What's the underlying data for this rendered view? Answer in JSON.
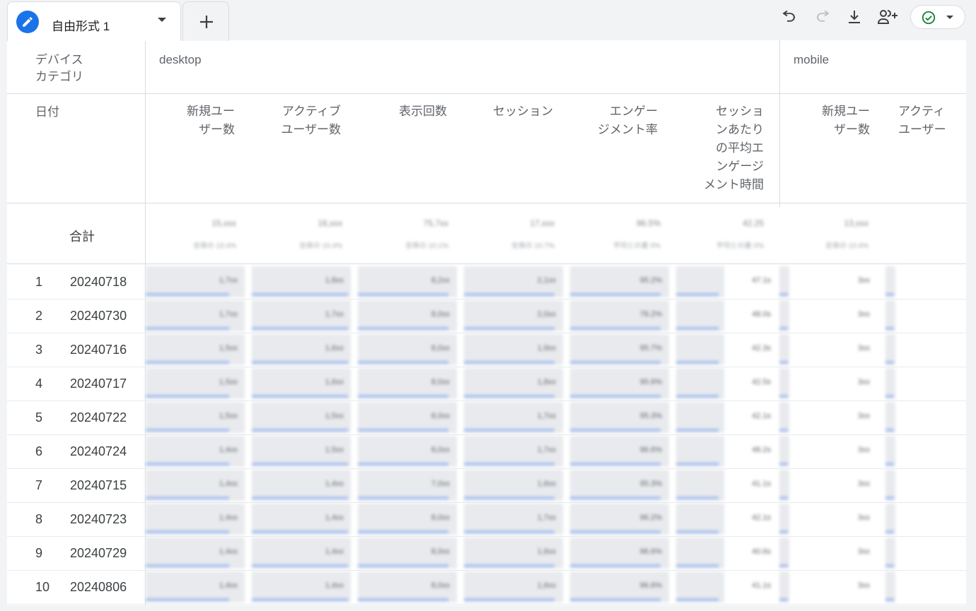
{
  "toolbar": {
    "tab_title": "自由形式 1",
    "icons": [
      "pencil-icon",
      "plus-icon",
      "undo-icon",
      "redo-icon",
      "download-icon",
      "share-user-icon",
      "check-circle-icon",
      "chevron-down-icon"
    ],
    "accent": "#1a73e8",
    "status_color": "#188038"
  },
  "table": {
    "dimension_header": "デバイス\nカテゴリ",
    "row_dimension_header": "日付",
    "device_groups": [
      "desktop",
      "mobile"
    ],
    "metrics": [
      "新規ユー\nザー数",
      "アクティブ\nユーザー数",
      "表示回数",
      "セッション",
      "エンゲー\nジメント率",
      "セッショ\nンあたり\nの平均エ\nンゲージ\nメント時間"
    ],
    "mobile_metrics": [
      "新規ユー\nザー数",
      "アクティ\nユーザー"
    ],
    "total_label": "合計",
    "total_values": [
      "15,xxx",
      "16,xxx",
      "75,7xx",
      "17,xxx",
      "96.5%",
      "42.25",
      "13,xxx"
    ],
    "total_sub": [
      "全体の 10.4%",
      "全体の 10.4%",
      "全体の 10.1%",
      "全体の 10.7%",
      "平均との差 0%",
      "平均との差 0%",
      "全体の 10.4%"
    ],
    "rows": [
      {
        "idx": "1",
        "date": "20240718",
        "v": [
          "1,7xx",
          "1,8xx",
          "8,2xx",
          "2,1xx",
          "95.2%",
          "47.1s",
          "3xx"
        ]
      },
      {
        "idx": "2",
        "date": "20240730",
        "v": [
          "1,7xx",
          "1,7xx",
          "8,0xx",
          "2,0xx",
          "78.2%",
          "48.0s",
          "3xx"
        ]
      },
      {
        "idx": "3",
        "date": "20240716",
        "v": [
          "1,5xx",
          "1,6xx",
          "8,0xx",
          "1,9xx",
          "95.7%",
          "42.3s",
          "3xx"
        ]
      },
      {
        "idx": "4",
        "date": "20240717",
        "v": [
          "1,5xx",
          "1,6xx",
          "8,0xx",
          "1,8xx",
          "95.6%",
          "42.5s",
          "3xx"
        ]
      },
      {
        "idx": "5",
        "date": "20240722",
        "v": [
          "1,5xx",
          "1,5xx",
          "8,0xx",
          "1,7xx",
          "95.3%",
          "42.1s",
          "3xx"
        ]
      },
      {
        "idx": "6",
        "date": "20240724",
        "v": [
          "1,4xx",
          "1,5xx",
          "8,0xx",
          "1,7xx",
          "96.6%",
          "48.2s",
          "3xx"
        ]
      },
      {
        "idx": "7",
        "date": "20240715",
        "v": [
          "1,4xx",
          "1,4xx",
          "7,0xx",
          "1,6xx",
          "95.3%",
          "41.1s",
          "3xx"
        ]
      },
      {
        "idx": "8",
        "date": "20240723",
        "v": [
          "1,4xx",
          "1,4xx",
          "8,0xx",
          "1,7xx",
          "96.2%",
          "42.1s",
          "3xx"
        ]
      },
      {
        "idx": "9",
        "date": "20240729",
        "v": [
          "1,4xx",
          "1,4xx",
          "8,0xx",
          "1,6xx",
          "96.6%",
          "40.6s",
          "3xx"
        ]
      },
      {
        "idx": "10",
        "date": "20240806",
        "v": [
          "1,4xx",
          "1,4xx",
          "8,0xx",
          "1,6xx",
          "96.6%",
          "41.1s",
          "3xx"
        ]
      }
    ]
  }
}
